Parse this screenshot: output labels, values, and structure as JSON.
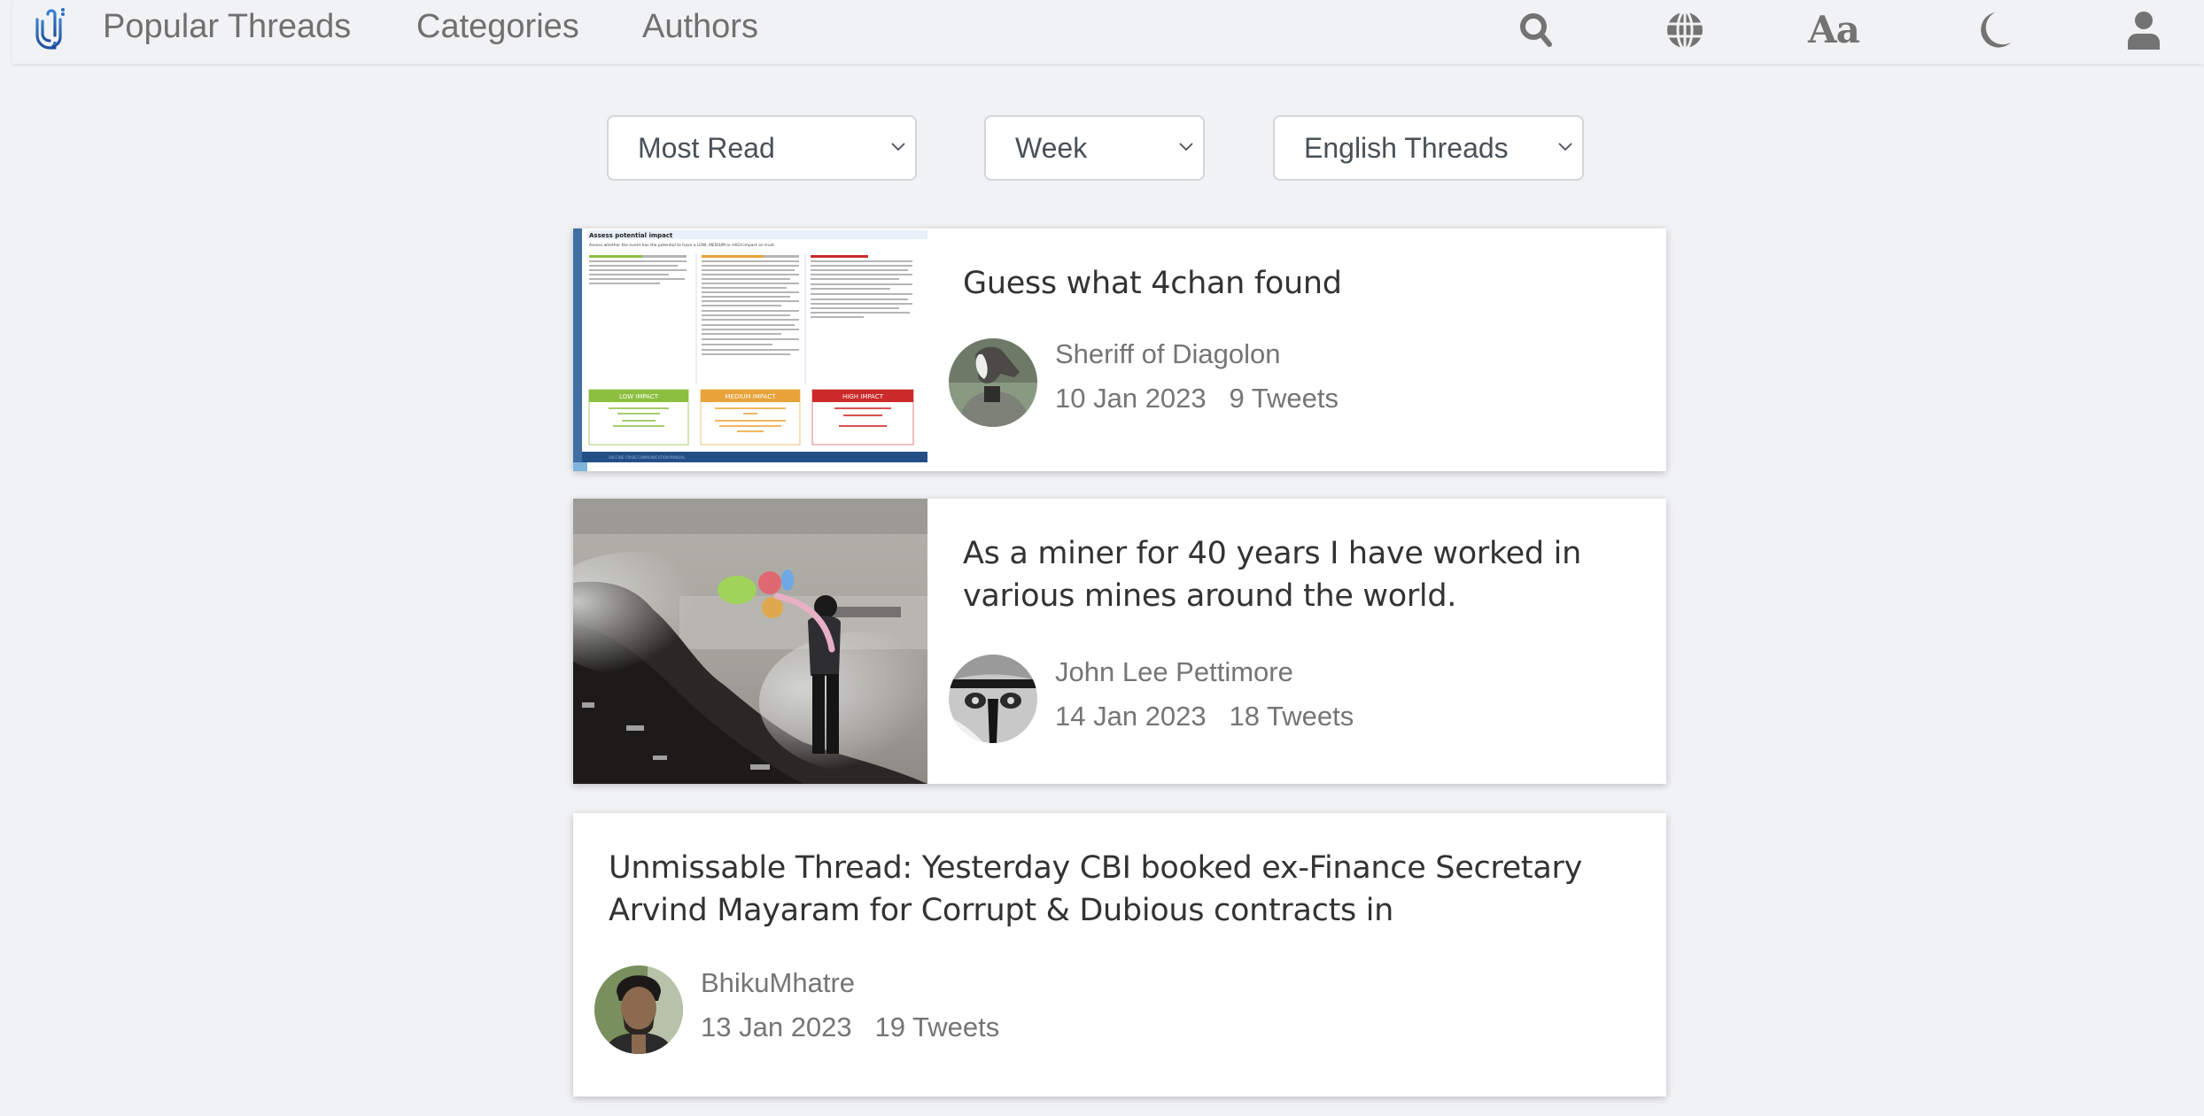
{
  "nav": {
    "logo": "app-logo",
    "links": [
      "Popular Threads",
      "Categories",
      "Authors"
    ],
    "icons": [
      "search-icon",
      "globe-icon",
      "font-size-icon",
      "moon-icon",
      "user-icon"
    ],
    "font_icon_text": "Aa"
  },
  "filters": {
    "sort": "Most Read",
    "period": "Week",
    "language": "English Threads"
  },
  "colors": {
    "background": "#f1f2f4",
    "logo_blue": "#2f6fbf",
    "icon_gray": "#737373",
    "title_text": "#333333",
    "meta_text": "#757575"
  },
  "threads": [
    {
      "title": "Guess what 4chan found",
      "author": "Sheriff of Diagolon",
      "date": "10 Jan 2023",
      "tweets": "9 Tweets",
      "thumbnail": {
        "heading": "Assess potential impact",
        "subheading": "Assess whether the event has the potential to have a LOW, MEDIUM or HIGH impact on trust.",
        "boxes": [
          "LOW IMPACT",
          "MEDIUM IMPACT",
          "HIGH IMPACT"
        ],
        "footer": "VACCINE CRISIS COMMUNICATION MANUAL"
      }
    },
    {
      "title": "As a miner for 40 years I have worked in various mines around the world.",
      "author": "John Lee Pettimore",
      "date": "14 Jan 2023",
      "tweets": "18 Tweets",
      "thumbnail": "photo-boy-with-balloons-smoke"
    },
    {
      "title": "Unmissable Thread: Yesterday CBI booked ex-Finance Secretary Arvind Mayaram for Corrupt & Dubious contracts in",
      "author": "BhikuMhatre",
      "date": "13 Jan 2023",
      "tweets": "19 Tweets"
    }
  ]
}
